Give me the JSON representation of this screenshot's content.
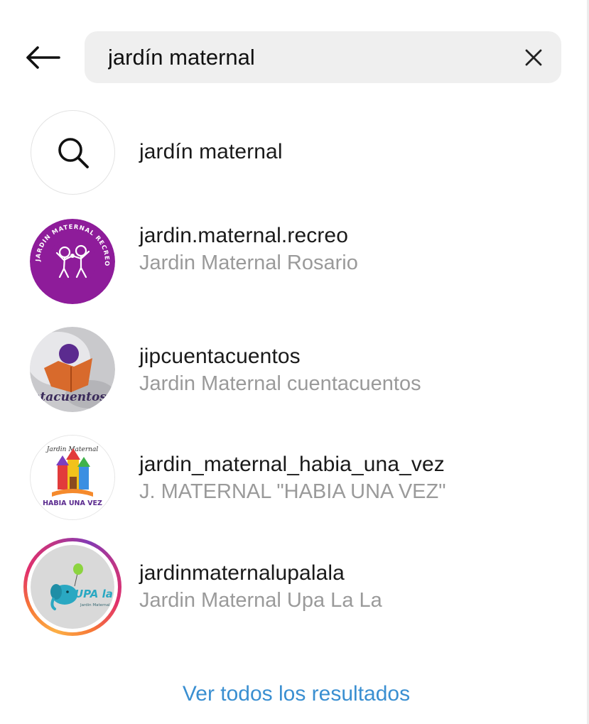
{
  "search": {
    "query": "jardín maternal",
    "back_icon": "arrow-left-icon",
    "clear_icon": "close-icon"
  },
  "query_suggestion": {
    "icon": "search-icon",
    "text": "jardín maternal"
  },
  "accounts": [
    {
      "username": "jardin.maternal.recreo",
      "full_name": "Jardin Maternal Rosario",
      "avatar_color": "#8e1c9a",
      "avatar_text": "JARDIN MATERNAL RECREO"
    },
    {
      "username": "jipcuentacuentos",
      "full_name": "Jardin Maternal cuentacuentos",
      "avatar_color": "#c9c9cc",
      "avatar_text": "ntacuentos"
    },
    {
      "username": "jardin_maternal_habia_una_vez",
      "full_name": "J. MATERNAL \"HABIA UNA VEZ\"",
      "avatar_color": "#ffffff",
      "avatar_text_top": "Jardin Maternal",
      "avatar_text_bottom": "HABIA UNA VEZ"
    },
    {
      "username": "jardinmaternalupalala",
      "full_name": "Jardin Maternal Upa La La",
      "avatar_color": "#d9d9d9",
      "avatar_text": "UPA la la",
      "avatar_subtext": "Jardin Maternal",
      "has_story": true
    }
  ],
  "footer": {
    "see_all_label": "Ver todos los resultados",
    "link_color": "#3a8fd1"
  }
}
